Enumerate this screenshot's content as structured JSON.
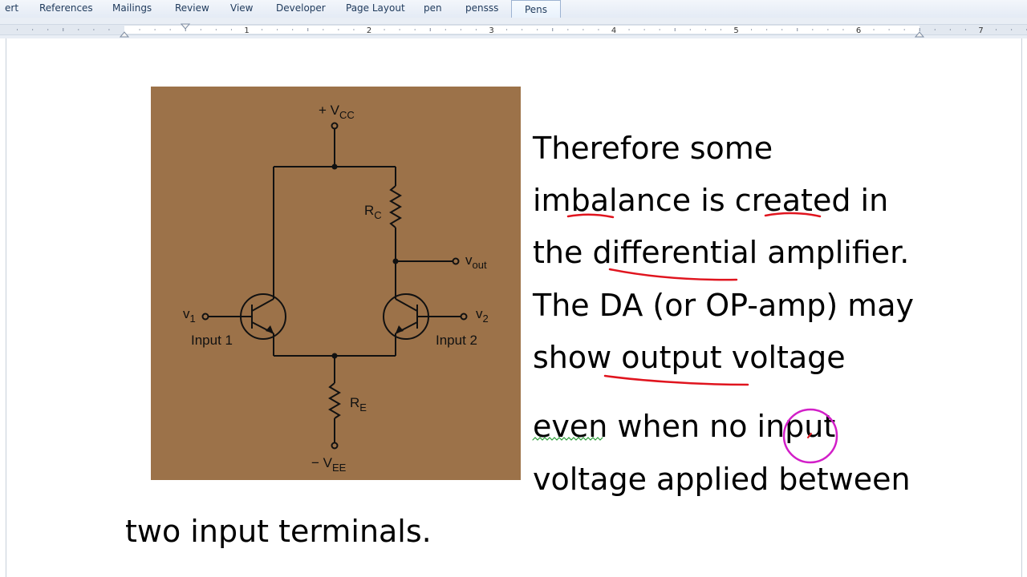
{
  "ribbon": {
    "tabs": [
      {
        "label": "ert"
      },
      {
        "label": "References"
      },
      {
        "label": "Mailings"
      },
      {
        "label": "Review"
      },
      {
        "label": "View"
      },
      {
        "label": "Developer"
      },
      {
        "label": "Page Layout"
      },
      {
        "label": "pen"
      },
      {
        "label": "pensss"
      },
      {
        "label": "Pens"
      }
    ],
    "active_tab": "Pens"
  },
  "ruler": {
    "numbers": [
      "1",
      "2",
      "3",
      "4",
      "5",
      "6",
      "7"
    ]
  },
  "document": {
    "paragraph_lines": [
      "Therefore some",
      "imbalance is created in",
      "the differential amplifier.",
      "The DA (or OP-amp) may",
      "show output voltage",
      "even when no input",
      "voltage applied between",
      "two input terminals."
    ],
    "figure": {
      "background": "#9c7249",
      "vcc_sign": "+ V",
      "vcc_sub": "CC",
      "rc_main": "R",
      "rc_sub": "C",
      "vout_main": "v",
      "vout_sub": "out",
      "v1_main": "v",
      "v1_sub": "1",
      "v2_main": "v",
      "v2_sub": "2",
      "input1_label": "Input 1",
      "input2_label": "Input 2",
      "re_main": "R",
      "re_sub": "E",
      "vee_sign": "− V",
      "vee_sub": "EE"
    },
    "annotation_colors": {
      "ink_red": "#e0141e",
      "ink_magenta": "#d21fc8",
      "spell_green": "#2f9e3b"
    }
  }
}
